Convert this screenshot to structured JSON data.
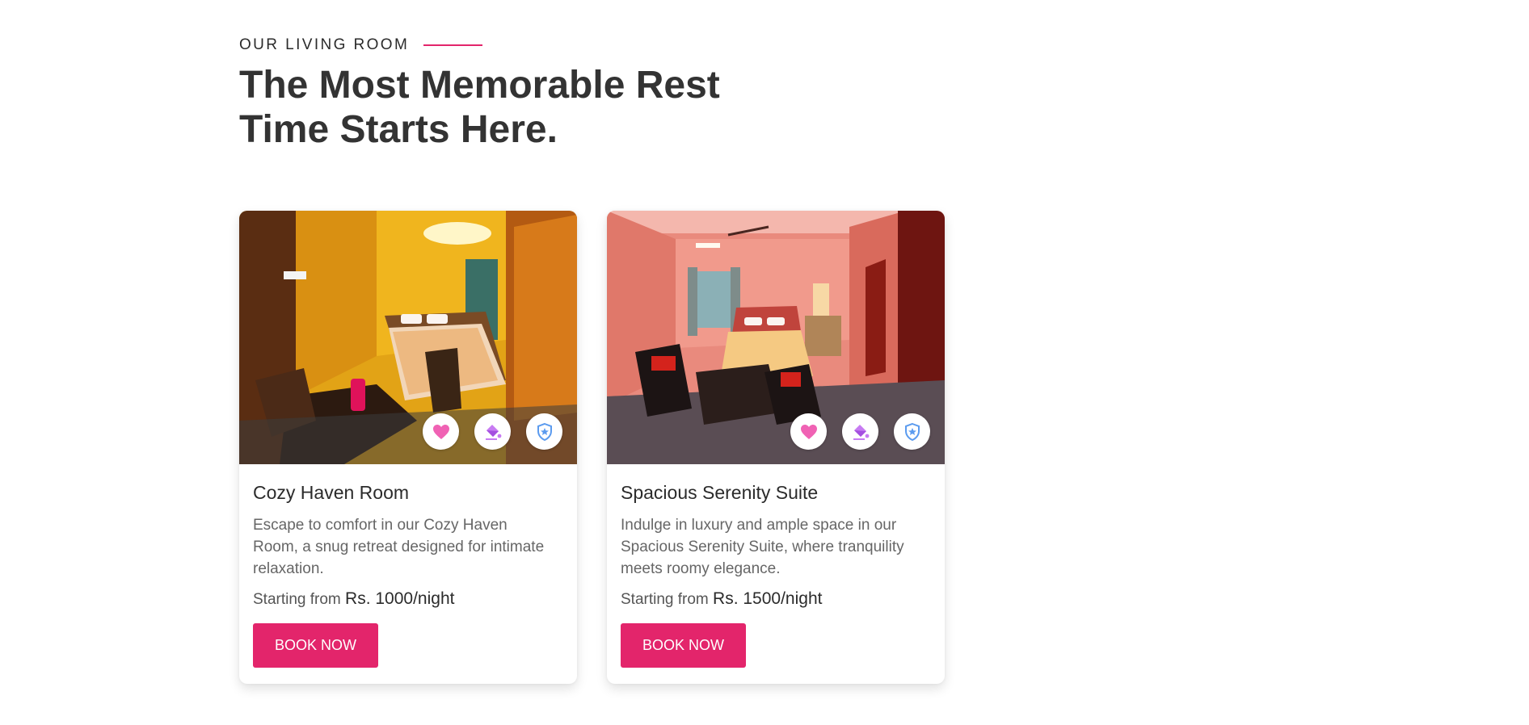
{
  "section": {
    "eyebrow": "OUR LIVING ROOM",
    "heading_line1": "The Most Memorable Rest",
    "heading_line2": "Time Starts Here."
  },
  "colors": {
    "accent": "#e3256b",
    "heart_icon": "#f062b4",
    "paint_icon": "#c77bf2",
    "shield_icon": "#5b9bef"
  },
  "rooms": [
    {
      "title": "Cozy Haven Room",
      "description": "Escape to comfort in our Cozy Haven Room, a snug retreat designed for intimate relaxation.",
      "price_prefix": "Starting from",
      "price": "Rs. 1000/night",
      "button": "BOOK NOW",
      "amenity_icons": [
        "heart-icon",
        "paint-bucket-icon",
        "shield-star-icon"
      ]
    },
    {
      "title": "Spacious Serenity Suite",
      "description": "Indulge in luxury and ample space in our Spacious Serenity Suite, where tranquility meets roomy elegance.",
      "price_prefix": "Starting from",
      "price": "Rs. 1500/night",
      "button": "BOOK NOW",
      "amenity_icons": [
        "heart-icon",
        "paint-bucket-icon",
        "shield-star-icon"
      ]
    }
  ]
}
